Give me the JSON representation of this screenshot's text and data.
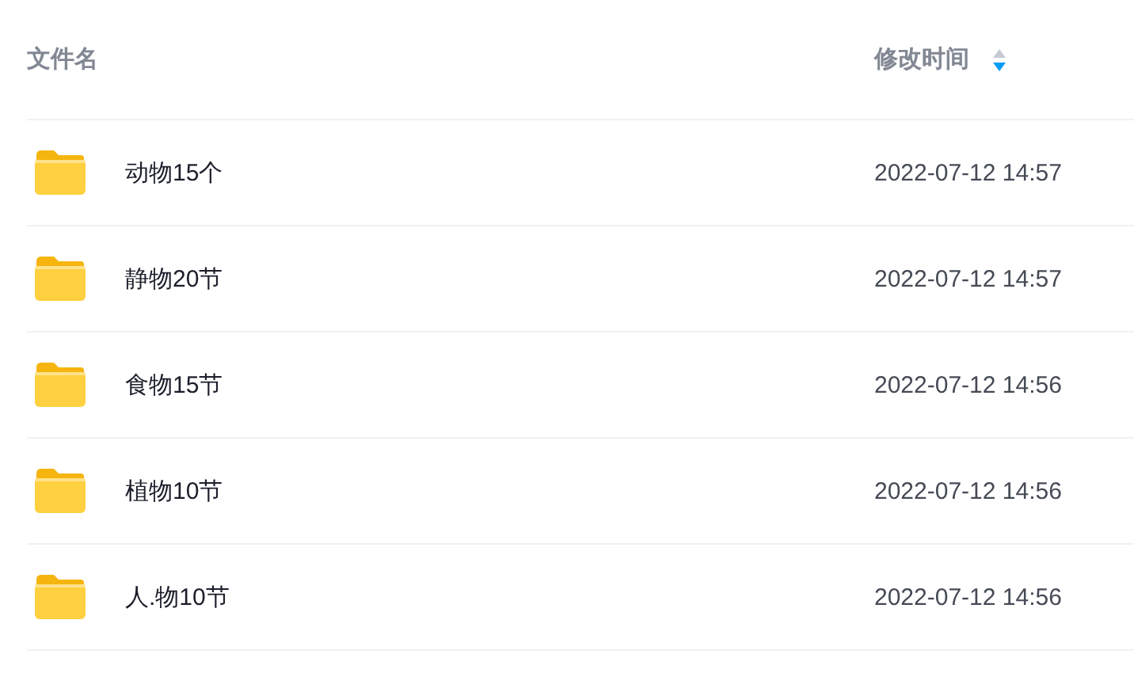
{
  "columns": [
    {
      "label": "文件名"
    },
    {
      "label": "修改时间",
      "sort_descending": true
    }
  ],
  "rows": [
    {
      "name": "动物15个",
      "modified": "2022-07-12 14:57"
    },
    {
      "name": "静物20节",
      "modified": "2022-07-12 14:57"
    },
    {
      "name": "食物15节",
      "modified": "2022-07-12 14:56"
    },
    {
      "name": "植物10节",
      "modified": "2022-07-12 14:56"
    },
    {
      "name": "人.物10节",
      "modified": "2022-07-12 14:56"
    }
  ]
}
